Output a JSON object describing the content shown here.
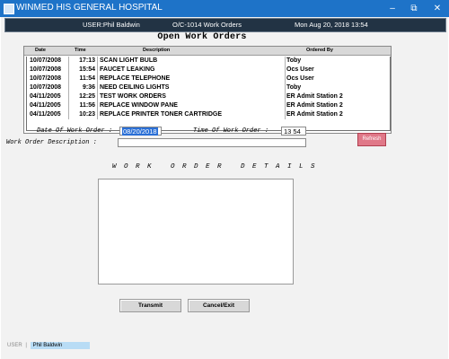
{
  "window": {
    "title": "WINMED HIS GENERAL HOSPITAL",
    "minimize_glyph": "–",
    "maximize_glyph": "⧉",
    "close_glyph": "✕"
  },
  "info_bar": {
    "user": "USER:Phil Baldwin",
    "screen": "O/C-1014  Work Orders",
    "datetime": "Mon Aug  20, 2018 13:54"
  },
  "form_title": "Open Work Orders",
  "table": {
    "headers": [
      "Date",
      "Time",
      "Description",
      "Ordered By"
    ],
    "rows": [
      {
        "date": "10/07/2008",
        "time": "17:13",
        "description": "SCAN LIGHT BULB",
        "ordered_by": "Toby"
      },
      {
        "date": "10/07/2008",
        "time": "15:54",
        "description": "FAUCET LEAKING",
        "ordered_by": "Ocs User"
      },
      {
        "date": "10/07/2008",
        "time": "11:54",
        "description": "REPLACE TELEPHONE",
        "ordered_by": "Ocs User"
      },
      {
        "date": "10/07/2008",
        "time": "9:36",
        "description": "NEED CEILING LIGHTS",
        "ordered_by": "Toby"
      },
      {
        "date": "04/11/2005",
        "time": "12:25",
        "description": "TEST WORK ORDERS",
        "ordered_by": "ER Admit Station 2"
      },
      {
        "date": "04/11/2005",
        "time": "11:56",
        "description": "REPLACE WINDOW PANE",
        "ordered_by": "ER Admit Station 2"
      },
      {
        "date": "04/11/2005",
        "time": "10:23",
        "description": "REPLACE PRINTER TONER CARTRIDGE",
        "ordered_by": "ER Admit Station 2"
      }
    ]
  },
  "fields": {
    "date_label": "Date Of Work Order :",
    "date_value": "08/20/2018",
    "time_label": "Time Of Work Order :",
    "time_value": "13 54",
    "description_label": "Work Order Description :",
    "description_value": ""
  },
  "refresh_label": "Refresh",
  "details_heading": "WORK ORDER DETAILS",
  "details_value": "",
  "buttons": {
    "transmit": "Transmit",
    "cancel": "Cancel/Exit"
  },
  "status_bar": {
    "label": "USER",
    "separator": "|",
    "user": "Phil Baldwin"
  },
  "colors": {
    "titlebar": "#1e73c8",
    "info_bar": "#223344",
    "refresh_button": "#e07888",
    "selection": "#2a6fd6"
  }
}
